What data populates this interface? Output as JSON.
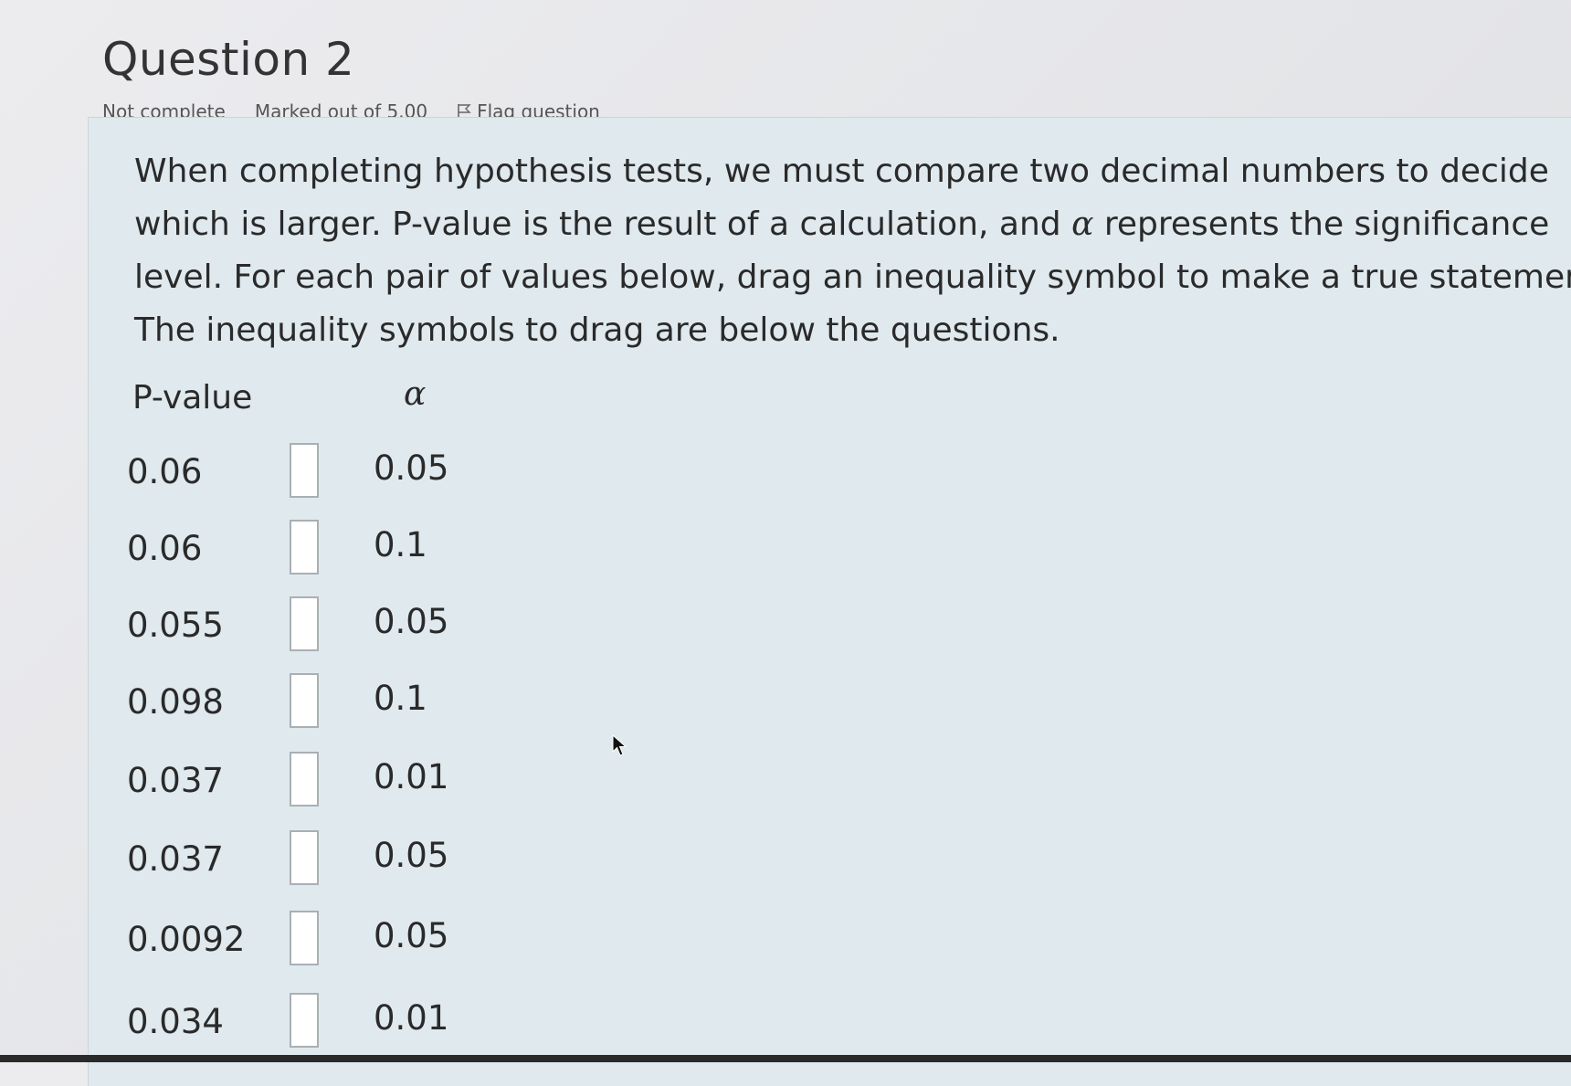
{
  "question": {
    "title": "Question 2",
    "status": "Not complete",
    "marks": "Marked out of 5.00",
    "flag_label": "Flag question"
  },
  "prompt": {
    "text_before_alpha": "When completing hypothesis tests, we must compare two decimal numbers to decide which is larger. P-value is the result of a calculation, and ",
    "alpha_symbol": "α",
    "text_after_alpha": " represents the significance level. For each pair of values below, drag an inequality symbol to make a true statement. The inequality symbols to drag are below the questions."
  },
  "table": {
    "header_pvalue": "P-value",
    "header_alpha": "α",
    "rows": [
      {
        "p": "0.06",
        "alpha": "0.05"
      },
      {
        "p": "0.06",
        "alpha": "0.1"
      },
      {
        "p": "0.055",
        "alpha": "0.05"
      },
      {
        "p": "0.098",
        "alpha": "0.1"
      },
      {
        "p": "0.037",
        "alpha": "0.01"
      },
      {
        "p": "0.037",
        "alpha": "0.05"
      },
      {
        "p": "0.0092",
        "alpha": "0.05"
      },
      {
        "p": "0.034",
        "alpha": "0.01"
      }
    ]
  },
  "icons": {
    "flag": "flag-icon",
    "cursor": "mouse-cursor-icon"
  }
}
